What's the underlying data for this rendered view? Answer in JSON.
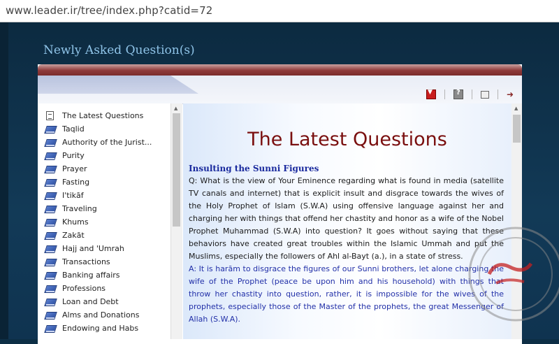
{
  "browser": {
    "url": "www.leader.ir/tree/index.php?catid=72"
  },
  "page": {
    "section_title": "Newly Asked Question(s)"
  },
  "sidebar": {
    "items": [
      {
        "label": "The Latest Questions",
        "icon": "document-icon"
      },
      {
        "label": "Taqlid",
        "icon": "book-icon"
      },
      {
        "label": "Authority of the Jurist...",
        "icon": "book-icon"
      },
      {
        "label": "Purity",
        "icon": "book-icon"
      },
      {
        "label": "Prayer",
        "icon": "book-icon"
      },
      {
        "label": "Fasting",
        "icon": "book-icon"
      },
      {
        "label": "I'tikāf",
        "icon": "book-icon"
      },
      {
        "label": "Traveling",
        "icon": "book-icon"
      },
      {
        "label": "Khums",
        "icon": "book-icon"
      },
      {
        "label": "Zakāt",
        "icon": "book-icon"
      },
      {
        "label": "Hajj and 'Umrah",
        "icon": "book-icon"
      },
      {
        "label": "Transactions",
        "icon": "book-icon"
      },
      {
        "label": "Banking affairs",
        "icon": "book-icon"
      },
      {
        "label": "Professions",
        "icon": "book-icon"
      },
      {
        "label": "Loan and Debt",
        "icon": "book-icon"
      },
      {
        "label": "Alms and Donations",
        "icon": "book-icon"
      },
      {
        "label": "Endowing and Habs",
        "icon": "book-icon"
      }
    ]
  },
  "content": {
    "title": "The Latest Questions",
    "heading": "Insulting the Sunni Figures",
    "question": "Q: What is the view of Your Eminence regarding what is found in media (satellite TV canals and internet) that is explicit insult and disgrace towards the wives of the Holy Prophet of Islam (S.W.A) using offensive language against her and charging her with things that offend her chastity and honor as a wife of the Nobel Prophet Muhammad (S.W.A) into question? It goes without saying that these behaviors have created great troubles within the Islamic Ummah and put the Muslims, especially the followers of Ahl al-Bayt (a.), in a state of stress.",
    "answer": "A: It is harām to disgrace the figures of our Sunni brothers, let alone charging the wife of the Prophet (peace be upon him and his household) with things that throw her chastity into question, rather, it is impossible for the wives of the prophets, especially those of the Master of the prophets, the great Messenger of Allah (S.W.A)."
  },
  "toolbar": {
    "icons": [
      "download-icon",
      "help-icon",
      "print-icon",
      "forward-icon"
    ]
  },
  "colors": {
    "title_red": "#7a0f0f",
    "heading_blue": "#1a2a9e",
    "answer_blue": "#2230a8",
    "page_background": "#0d2e45"
  }
}
